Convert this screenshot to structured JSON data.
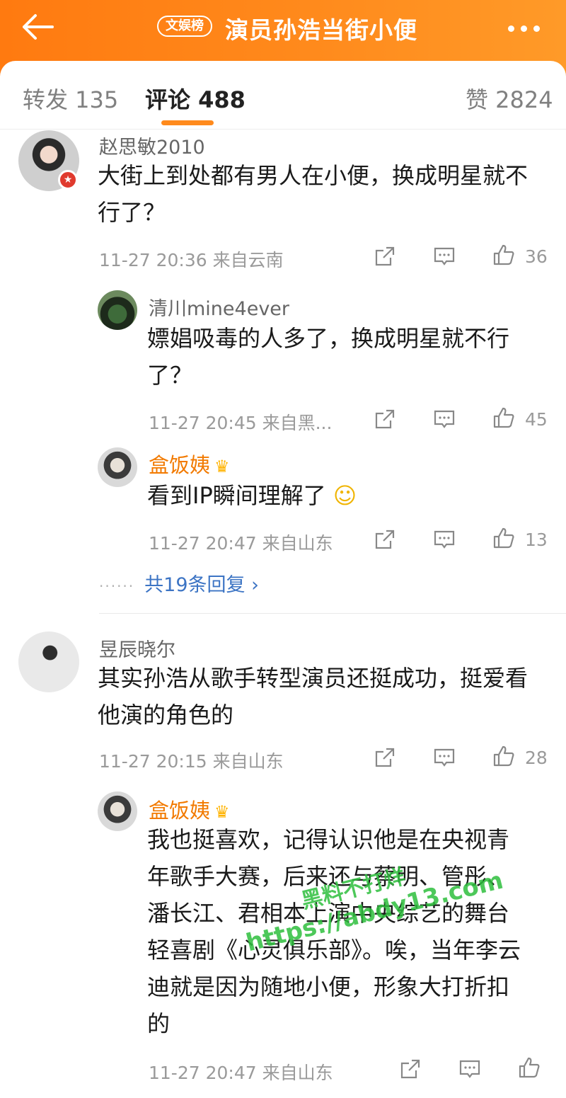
{
  "header": {
    "back_icon": "arrow-left-icon",
    "tag": "文娱榜",
    "title": "演员孙浩当街小便",
    "more_icon": "more-dots-icon"
  },
  "tabs": {
    "repost": "转发 135",
    "comments": "评论 488",
    "likes": "赞 2824"
  },
  "colors": {
    "brand": "#ff8a1c",
    "link": "#3c74c4",
    "gold_name": "#f27a00"
  },
  "comments": [
    {
      "user": "赵思敏2010",
      "text_lines": [
        "大街上到处都有男人在小便，换成明星就不",
        "行了？"
      ],
      "meta": "11-27 20:36  来自云南",
      "likes": "36",
      "replies": [
        {
          "user": "清川mine4ever",
          "text_lines": [
            "嫖娼吸毒的人多了，换成明星就不行",
            "了？"
          ],
          "meta": "11-27 20:45  来自黑...",
          "likes": "45"
        },
        {
          "user": "盒饭姨",
          "text_lines": [
            "看到IP瞬间理解了"
          ],
          "meta": "11-27 20:47  来自山东",
          "likes": "13"
        }
      ],
      "more_replies": "共19条回复 ›"
    },
    {
      "user": "昱辰晓尔",
      "text_lines": [
        "其实孙浩从歌手转型演员还挺成功，挺爱看",
        "他演的角色的"
      ],
      "meta": "11-27 20:15  来自山东",
      "likes": "28",
      "replies": [
        {
          "user": "盒饭姨",
          "text_lines": [
            "我也挺喜欢，记得认识他是在央视青",
            "年歌手大赛，后来还与蔡明、管彤、",
            "潘长江、君相本上演中央综艺的舞台",
            "轻喜剧《心灵俱乐部》。唉，当年李云",
            "迪就是因为随地小便，形象大打折扣",
            "的"
          ],
          "meta": "11-27 20:47  来自山东",
          "likes": ""
        }
      ]
    }
  ],
  "watermark": {
    "line1": "黑料不打烊",
    "line2": "https://abdy13.com"
  }
}
